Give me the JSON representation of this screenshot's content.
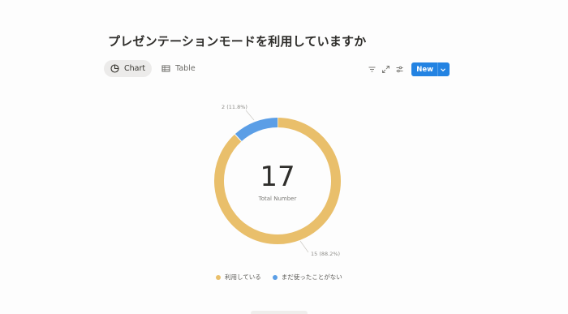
{
  "page": {
    "title": "プレゼンテーションモードを利用していますか"
  },
  "view_tabs": [
    {
      "label": "Chart",
      "icon": "pie-chart-icon",
      "active": true
    },
    {
      "label": "Table",
      "icon": "table-icon",
      "active": false
    }
  ],
  "toolbar": {
    "filter_icon": "filter-icon",
    "expand_icon": "expand-icon",
    "settings_icon": "sliders-icon",
    "new_label": "New",
    "new_caret_icon": "chevron-down-icon",
    "accent_color": "#2383e2"
  },
  "chart_data": {
    "type": "pie",
    "donut": true,
    "total": 17,
    "center_value": "17",
    "center_caption": "Total Number",
    "slices": [
      {
        "name": "利用している",
        "value": 15,
        "percent": 88.2,
        "label": "15 (88.2%)",
        "color": "#e9bf6b"
      },
      {
        "name": "まだ使ったことがない",
        "value": 2,
        "percent": 11.8,
        "label": "2 (11.8%)",
        "color": "#5b9ee6"
      }
    ],
    "legend_placement": "bottom"
  }
}
